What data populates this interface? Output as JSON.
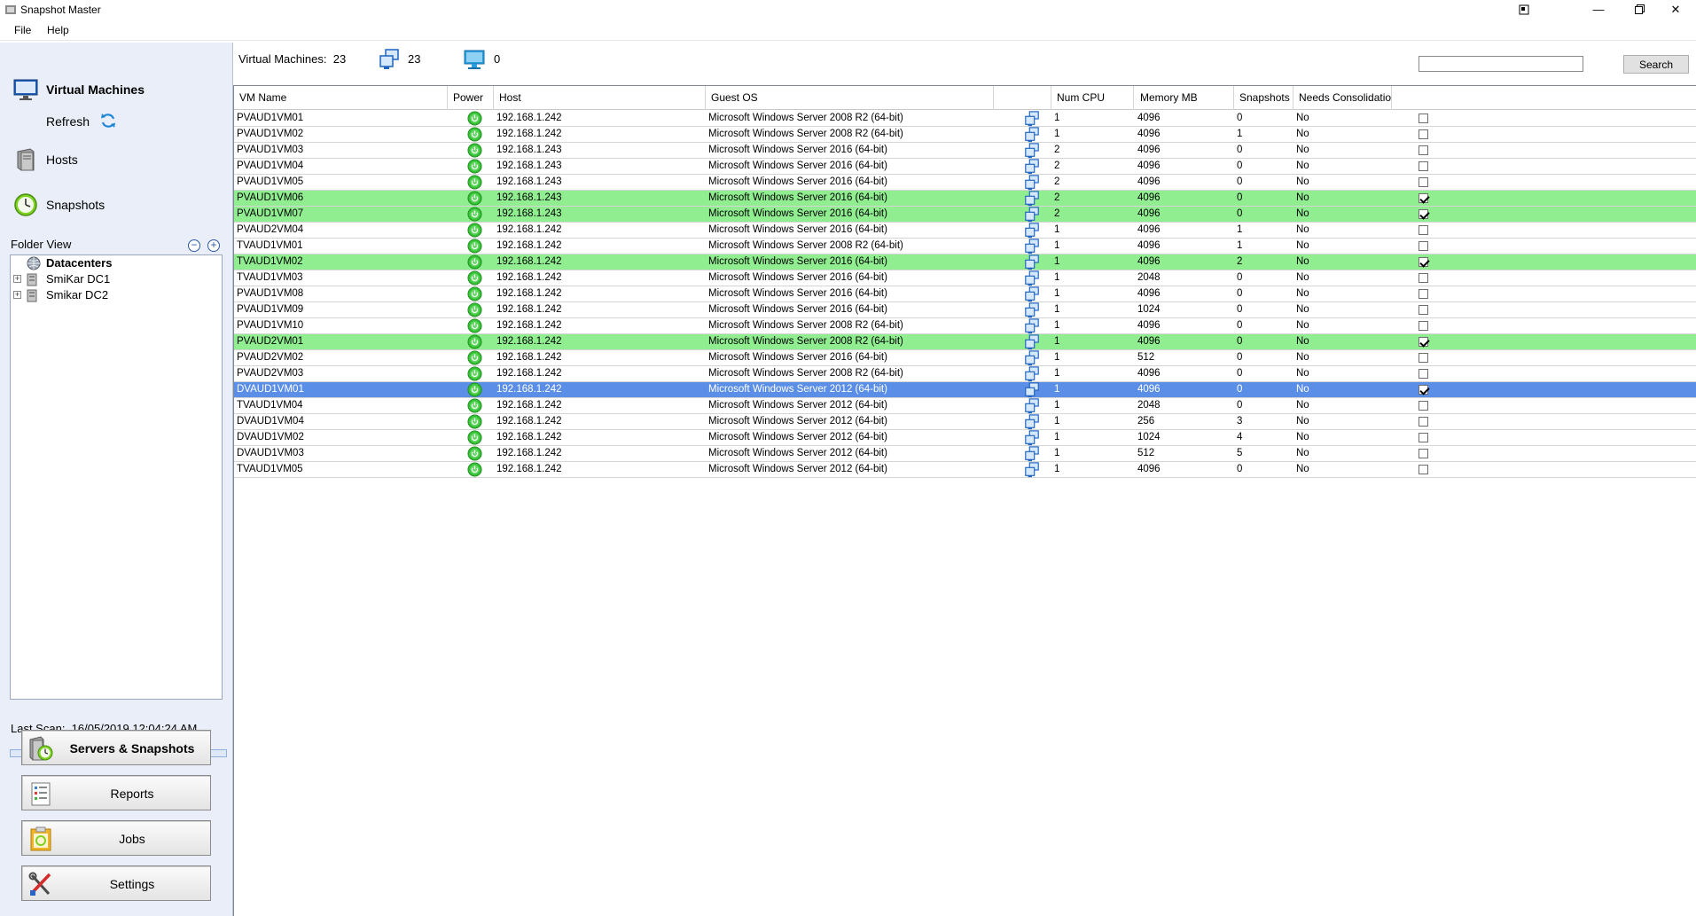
{
  "window": {
    "title": "Snapshot Master",
    "menu": [
      "File",
      "Help"
    ]
  },
  "nav": {
    "virtual_machines": "Virtual Machines",
    "refresh": "Refresh",
    "hosts": "Hosts",
    "snapshots": "Snapshots"
  },
  "folder_view": {
    "label": "Folder View",
    "root": "Datacenters",
    "children": [
      "SmiKar DC1",
      "Smikar DC2"
    ]
  },
  "last_scan": {
    "label": "Last Scan:",
    "value": "16/05/2019 12:04:24 AM"
  },
  "buttons": {
    "servers_snapshots": "Servers & Snapshots",
    "reports": "Reports",
    "jobs": "Jobs",
    "settings": "Settings"
  },
  "toolbar": {
    "vm_count_label": "Virtual Machines:",
    "vm_count": "23",
    "template_count": "23",
    "powered_count": "0",
    "search_label": "Search",
    "search_value": ""
  },
  "colors": {
    "row_green": "#90ee90",
    "row_selected": "#5b8ee6",
    "power_on": "#35c235",
    "panel_bg": "#e9eef8"
  },
  "grid": {
    "columns": [
      "VM Name",
      "Power",
      "Host",
      "Guest OS",
      "",
      "Num CPU",
      "Memory MB",
      "Snapshots",
      "Needs Consolidation"
    ],
    "rows": [
      {
        "name": "PVAUD1VM01",
        "host": "192.168.1.242",
        "os": "Microsoft Windows Server 2008 R2 (64-bit)",
        "cpu": "1",
        "mem": "4096",
        "snaps": "0",
        "consolidate": "No",
        "checked": false,
        "state": "normal"
      },
      {
        "name": "PVAUD1VM02",
        "host": "192.168.1.242",
        "os": "Microsoft Windows Server 2008 R2 (64-bit)",
        "cpu": "1",
        "mem": "4096",
        "snaps": "1",
        "consolidate": "No",
        "checked": false,
        "state": "normal"
      },
      {
        "name": "PVAUD1VM03",
        "host": "192.168.1.243",
        "os": "Microsoft Windows Server 2016 (64-bit)",
        "cpu": "2",
        "mem": "4096",
        "snaps": "0",
        "consolidate": "No",
        "checked": false,
        "state": "normal"
      },
      {
        "name": "PVAUD1VM04",
        "host": "192.168.1.243",
        "os": "Microsoft Windows Server 2016 (64-bit)",
        "cpu": "2",
        "mem": "4096",
        "snaps": "0",
        "consolidate": "No",
        "checked": false,
        "state": "normal"
      },
      {
        "name": "PVAUD1VM05",
        "host": "192.168.1.243",
        "os": "Microsoft Windows Server 2016 (64-bit)",
        "cpu": "2",
        "mem": "4096",
        "snaps": "0",
        "consolidate": "No",
        "checked": false,
        "state": "normal"
      },
      {
        "name": "PVAUD1VM06",
        "host": "192.168.1.243",
        "os": "Microsoft Windows Server 2016 (64-bit)",
        "cpu": "2",
        "mem": "4096",
        "snaps": "0",
        "consolidate": "No",
        "checked": true,
        "state": "green"
      },
      {
        "name": "PVAUD1VM07",
        "host": "192.168.1.243",
        "os": "Microsoft Windows Server 2016 (64-bit)",
        "cpu": "2",
        "mem": "4096",
        "snaps": "0",
        "consolidate": "No",
        "checked": true,
        "state": "green"
      },
      {
        "name": "PVAUD2VM04",
        "host": "192.168.1.242",
        "os": "Microsoft Windows Server 2016 (64-bit)",
        "cpu": "1",
        "mem": "4096",
        "snaps": "1",
        "consolidate": "No",
        "checked": false,
        "state": "normal"
      },
      {
        "name": "TVAUD1VM01",
        "host": "192.168.1.242",
        "os": "Microsoft Windows Server 2008 R2 (64-bit)",
        "cpu": "1",
        "mem": "4096",
        "snaps": "1",
        "consolidate": "No",
        "checked": false,
        "state": "normal"
      },
      {
        "name": "TVAUD1VM02",
        "host": "192.168.1.242",
        "os": "Microsoft Windows Server 2016 (64-bit)",
        "cpu": "1",
        "mem": "4096",
        "snaps": "2",
        "consolidate": "No",
        "checked": true,
        "state": "green"
      },
      {
        "name": "TVAUD1VM03",
        "host": "192.168.1.242",
        "os": "Microsoft Windows Server 2016 (64-bit)",
        "cpu": "1",
        "mem": "2048",
        "snaps": "0",
        "consolidate": "No",
        "checked": false,
        "state": "normal"
      },
      {
        "name": "PVAUD1VM08",
        "host": "192.168.1.242",
        "os": "Microsoft Windows Server 2016 (64-bit)",
        "cpu": "1",
        "mem": "4096",
        "snaps": "0",
        "consolidate": "No",
        "checked": false,
        "state": "normal"
      },
      {
        "name": "PVAUD1VM09",
        "host": "192.168.1.242",
        "os": "Microsoft Windows Server 2016 (64-bit)",
        "cpu": "1",
        "mem": "1024",
        "snaps": "0",
        "consolidate": "No",
        "checked": false,
        "state": "normal"
      },
      {
        "name": "PVAUD1VM10",
        "host": "192.168.1.242",
        "os": "Microsoft Windows Server 2008 R2 (64-bit)",
        "cpu": "1",
        "mem": "4096",
        "snaps": "0",
        "consolidate": "No",
        "checked": false,
        "state": "normal"
      },
      {
        "name": "PVAUD2VM01",
        "host": "192.168.1.242",
        "os": "Microsoft Windows Server 2008 R2 (64-bit)",
        "cpu": "1",
        "mem": "4096",
        "snaps": "0",
        "consolidate": "No",
        "checked": true,
        "state": "green"
      },
      {
        "name": "PVAUD2VM02",
        "host": "192.168.1.242",
        "os": "Microsoft Windows Server 2016 (64-bit)",
        "cpu": "1",
        "mem": "512",
        "snaps": "0",
        "consolidate": "No",
        "checked": false,
        "state": "normal"
      },
      {
        "name": "PVAUD2VM03",
        "host": "192.168.1.242",
        "os": "Microsoft Windows Server 2008 R2 (64-bit)",
        "cpu": "1",
        "mem": "4096",
        "snaps": "0",
        "consolidate": "No",
        "checked": false,
        "state": "normal"
      },
      {
        "name": "DVAUD1VM01",
        "host": "192.168.1.242",
        "os": "Microsoft Windows Server 2012 (64-bit)",
        "cpu": "1",
        "mem": "4096",
        "snaps": "0",
        "consolidate": "No",
        "checked": true,
        "state": "selected"
      },
      {
        "name": "TVAUD1VM04",
        "host": "192.168.1.242",
        "os": "Microsoft Windows Server 2012 (64-bit)",
        "cpu": "1",
        "mem": "2048",
        "snaps": "0",
        "consolidate": "No",
        "checked": false,
        "state": "normal"
      },
      {
        "name": "DVAUD1VM04",
        "host": "192.168.1.242",
        "os": "Microsoft Windows Server 2012 (64-bit)",
        "cpu": "1",
        "mem": "256",
        "snaps": "3",
        "consolidate": "No",
        "checked": false,
        "state": "normal"
      },
      {
        "name": "DVAUD1VM02",
        "host": "192.168.1.242",
        "os": "Microsoft Windows Server 2012 (64-bit)",
        "cpu": "1",
        "mem": "1024",
        "snaps": "4",
        "consolidate": "No",
        "checked": false,
        "state": "normal"
      },
      {
        "name": "DVAUD1VM03",
        "host": "192.168.1.242",
        "os": "Microsoft Windows Server 2012 (64-bit)",
        "cpu": "1",
        "mem": "512",
        "snaps": "5",
        "consolidate": "No",
        "checked": false,
        "state": "normal"
      },
      {
        "name": "TVAUD1VM05",
        "host": "192.168.1.242",
        "os": "Microsoft Windows Server 2012 (64-bit)",
        "cpu": "1",
        "mem": "4096",
        "snaps": "0",
        "consolidate": "No",
        "checked": false,
        "state": "normal"
      }
    ]
  }
}
